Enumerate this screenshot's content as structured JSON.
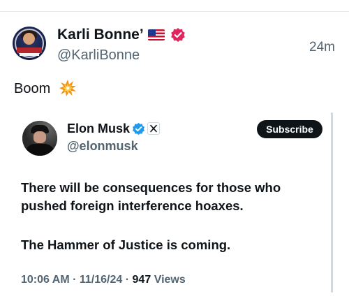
{
  "post": {
    "author_name": "Karli Bonne’",
    "author_handle": "@KarliBonne",
    "time_ago": "24m",
    "text": "Boom",
    "icons": {
      "avatar": "avatar-image",
      "flag": "us-flag-emoji",
      "verified": "pink-verified-icon",
      "emoji": "collision-emoji"
    }
  },
  "quoted": {
    "author_name": "Elon Musk",
    "author_handle": "@elonmusk",
    "subscribe_label": "Subscribe",
    "line1": "There will be consequences for those who",
    "line2": "pushed foreign interference hoaxes.",
    "line3": "The Hammer of Justice is coming.",
    "time": "10:06 AM",
    "date": "11/16/24",
    "views_count": "947",
    "views_label": "Views",
    "separator": "·",
    "icons": {
      "verified": "blue-verified-icon",
      "affiliate": "x-logo-icon",
      "avatar": "avatar-image"
    }
  },
  "colors": {
    "text_primary": "#0f1419",
    "text_secondary": "#536471",
    "verified_blue": "#1d9bf0",
    "verified_pink": "#e0245e",
    "divider": "#e7e9ea"
  }
}
